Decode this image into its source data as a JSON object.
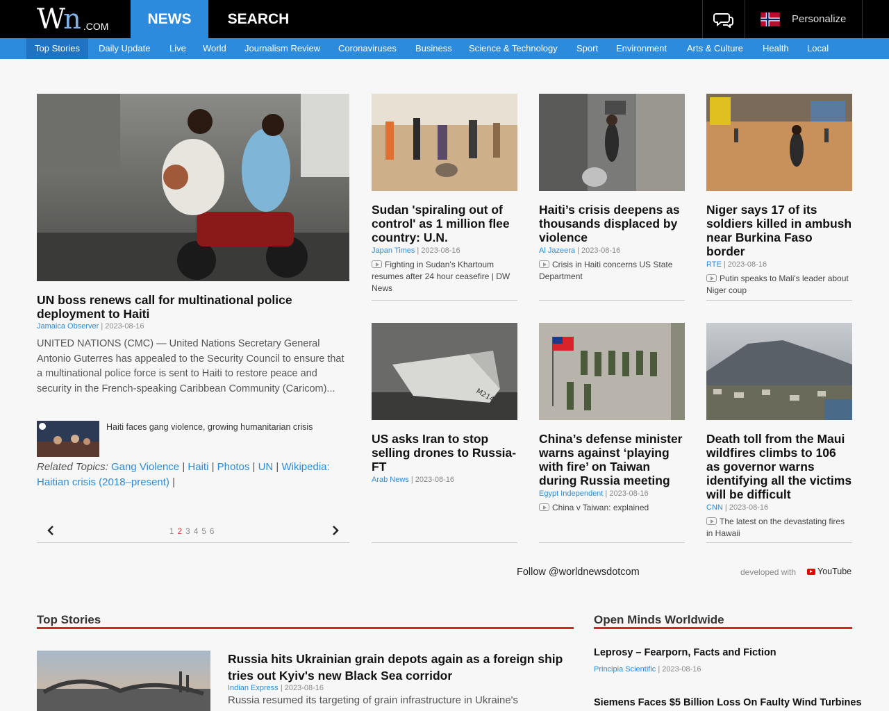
{
  "header": {
    "logo_wn": "W",
    "logo_n": "n",
    "logo_com": ".COM",
    "nav_news": "NEWS",
    "nav_search": "SEARCH",
    "personalize": "Personalize"
  },
  "subnav": [
    "Top Stories",
    "Daily Update",
    "Live",
    "World",
    "Journalism Review",
    "Coronaviruses",
    "Business",
    "Science & Technology",
    "Sport",
    "Environment",
    "Arts & Culture",
    "Health",
    "Local"
  ],
  "feature": {
    "title": "UN boss renews call for multinational police deployment to Haiti",
    "source": "Jamaica Observer",
    "date": "2023-08-16",
    "body": "UNITED NATIONS (CMC) — United Nations Secretary General Antonio Guterres has appealed to the Security Council to ensure that a multinational police force is sent to Haiti to restore peace and security in the French-speaking Caribbean Community (Caricom)...",
    "video_label": "Haiti faces gang violence, growing humanitarian crisis",
    "related_label": "Related Topics:",
    "related": [
      "Gang Violence",
      "Haiti",
      "Photos",
      "UN",
      "Wikipedia: Haitian crisis (2018–present)"
    ],
    "pages": [
      "1",
      "2",
      "3",
      "4",
      "5",
      "6"
    ],
    "current_page": "2"
  },
  "cards": [
    {
      "title": "Sudan 'spiraling out of control' as 1 million flee country: U.N.",
      "source": "Japan Times",
      "date": "2023-08-16",
      "video": "Fighting in Sudan's Khartoum resumes after 24 hour ceasefire | DW News"
    },
    {
      "title": "Haiti’s crisis deepens as thousands displaced by violence",
      "source": "Al Jazeera",
      "date": "2023-08-16",
      "video": "Crisis in Haiti concerns US State Department"
    },
    {
      "title": "Niger says 17 of its soldiers killed in ambush near Burkina Faso border",
      "source": "RTE",
      "date": "2023-08-16",
      "video": "Putin speaks to Mali's leader about Niger coup"
    },
    {
      "title": "US asks Iran to stop selling drones to Russia-FT",
      "source": "Arab News",
      "date": "2023-08-16",
      "video": ""
    },
    {
      "title": "China’s defense minister warns against ‘playing with fire’ on Taiwan during Russia meeting",
      "source": "Egypt Independent",
      "date": "2023-08-16",
      "video": "China v Taiwan: explained"
    },
    {
      "title": "Death toll from the Maui wildfires climbs to 106 as governor warns identifying all the victims will be difficult",
      "source": "CNN",
      "date": "2023-08-16",
      "video": "The latest on the devastating fires in Hawaii"
    }
  ],
  "follow": {
    "text": "Follow @worldnewsdotcom",
    "developed_with": "developed with",
    "youtube": "YouTube"
  },
  "top_stories": {
    "heading": "Top Stories",
    "title": "Russia hits Ukrainian grain depots again as a foreign ship tries out Kyiv's new Black Sea corridor",
    "source": "Indian Express",
    "date": "2023-08-16",
    "body": "Russia resumed its targeting of grain infrastructure in Ukraine's"
  },
  "open_minds": {
    "heading": "Open Minds Worldwide",
    "items": [
      {
        "title": "Leprosy – Fearporn, Facts and Fiction",
        "source": "Principia Scientific",
        "date": "2023-08-16"
      },
      {
        "title": "Siemens Faces $5 Billion Loss On Faulty Wind Turbines",
        "source": "",
        "date": ""
      }
    ]
  },
  "colors": {
    "accent": "#2c8bdc",
    "accent_dark": "#1f73c2",
    "section_rule": "#d8232a",
    "topbar": "#000000"
  }
}
